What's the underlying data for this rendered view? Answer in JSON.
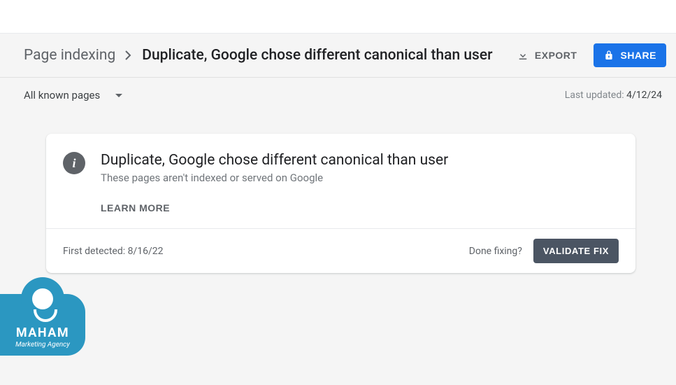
{
  "breadcrumb": {
    "parent": "Page indexing",
    "current": "Duplicate, Google chose different canonical than user"
  },
  "actions": {
    "export": "EXPORT",
    "share": "SHARE"
  },
  "filter": {
    "label": "All known pages"
  },
  "meta": {
    "last_updated_label": "Last updated: ",
    "last_updated_date": "4/12/24"
  },
  "card": {
    "title": "Duplicate, Google chose different canonical than user",
    "subtitle": "These pages aren't indexed or served on Google",
    "learn_more": "LEARN MORE",
    "first_detected_label": "First detected: ",
    "first_detected_date": "8/16/22",
    "done_fixing": "Done fixing?",
    "validate": "VALIDATE FIX"
  },
  "info_glyph": "i",
  "logo": {
    "name": "MAHAM",
    "tagline": "Marketing Agency"
  }
}
